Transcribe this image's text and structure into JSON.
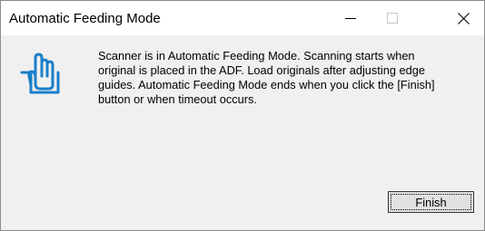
{
  "window": {
    "title": "Automatic Feeding Mode",
    "controls": {
      "minimize_icon": "minimize-icon",
      "maximize_icon": "maximize-icon",
      "close_icon": "close-icon"
    }
  },
  "dialog": {
    "icon": "adf-feed-icon",
    "icon_color": "#1a7fc9",
    "message_lines": [
      "Scanner is in Automatic Feeding Mode. Scanning starts when",
      "original is placed in the ADF. Load originals after adjusting edge",
      "guides. Automatic Feeding Mode ends when you click the [Finish]",
      "button or when timeout occurs."
    ],
    "finish_label": "Finish"
  }
}
